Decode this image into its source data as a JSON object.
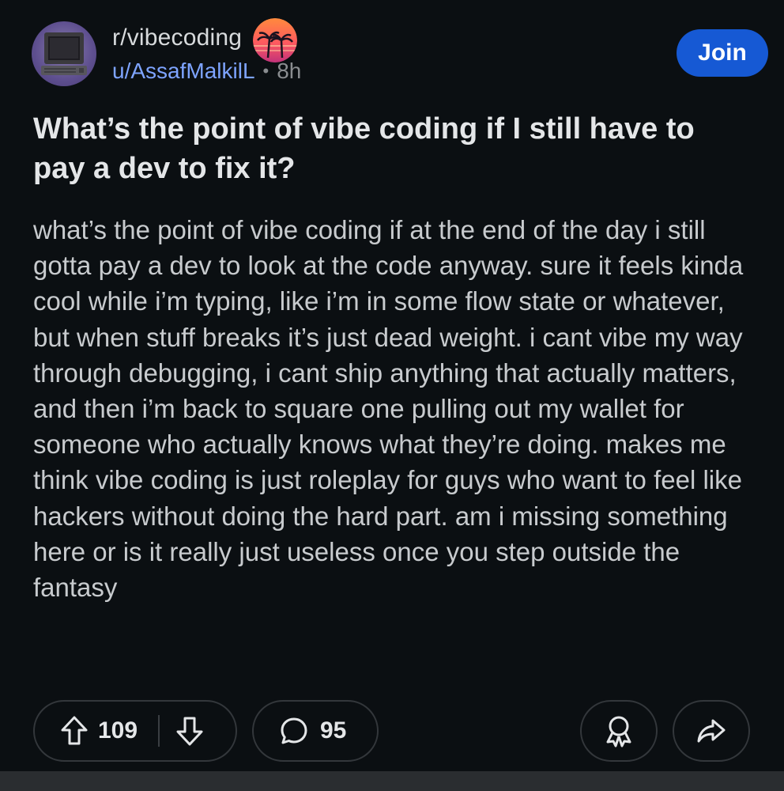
{
  "header": {
    "subreddit": "r/vibecoding",
    "username": "u/AssafMalkilL",
    "separator": "•",
    "time_ago": "8h",
    "join_label": "Join"
  },
  "post": {
    "title": "What’s the point of vibe coding if I still have to pay a dev to fix it?",
    "body": "what’s the point of vibe coding if at the end of the day i still gotta pay a dev to look at the code anyway. sure it feels kinda cool while i’m typing, like i’m in some flow state or whatever, but when stuff breaks it’s just dead weight. i cant vibe my way through debugging, i cant ship anything that actually matters, and then i’m back to square one pulling out my wallet for someone who actually knows what they’re doing. makes me think vibe coding is just roleplay for guys who want to feel like hackers without doing the hard part. am i missing something here or is it really just useless once you step outside the fantasy"
  },
  "actions": {
    "upvotes": "109",
    "comments": "95"
  },
  "icons": {
    "avatar": "retro-computer-avatar",
    "community": "palm-sunset-icon",
    "upvote": "arrow-up-icon",
    "downvote": "arrow-down-icon",
    "comment": "comment-bubble-icon",
    "award": "award-icon",
    "share": "share-icon"
  },
  "colors": {
    "background": "#0b0f12",
    "accent": "#1659d4",
    "username": "#7ea4ff",
    "border": "#33373b"
  }
}
